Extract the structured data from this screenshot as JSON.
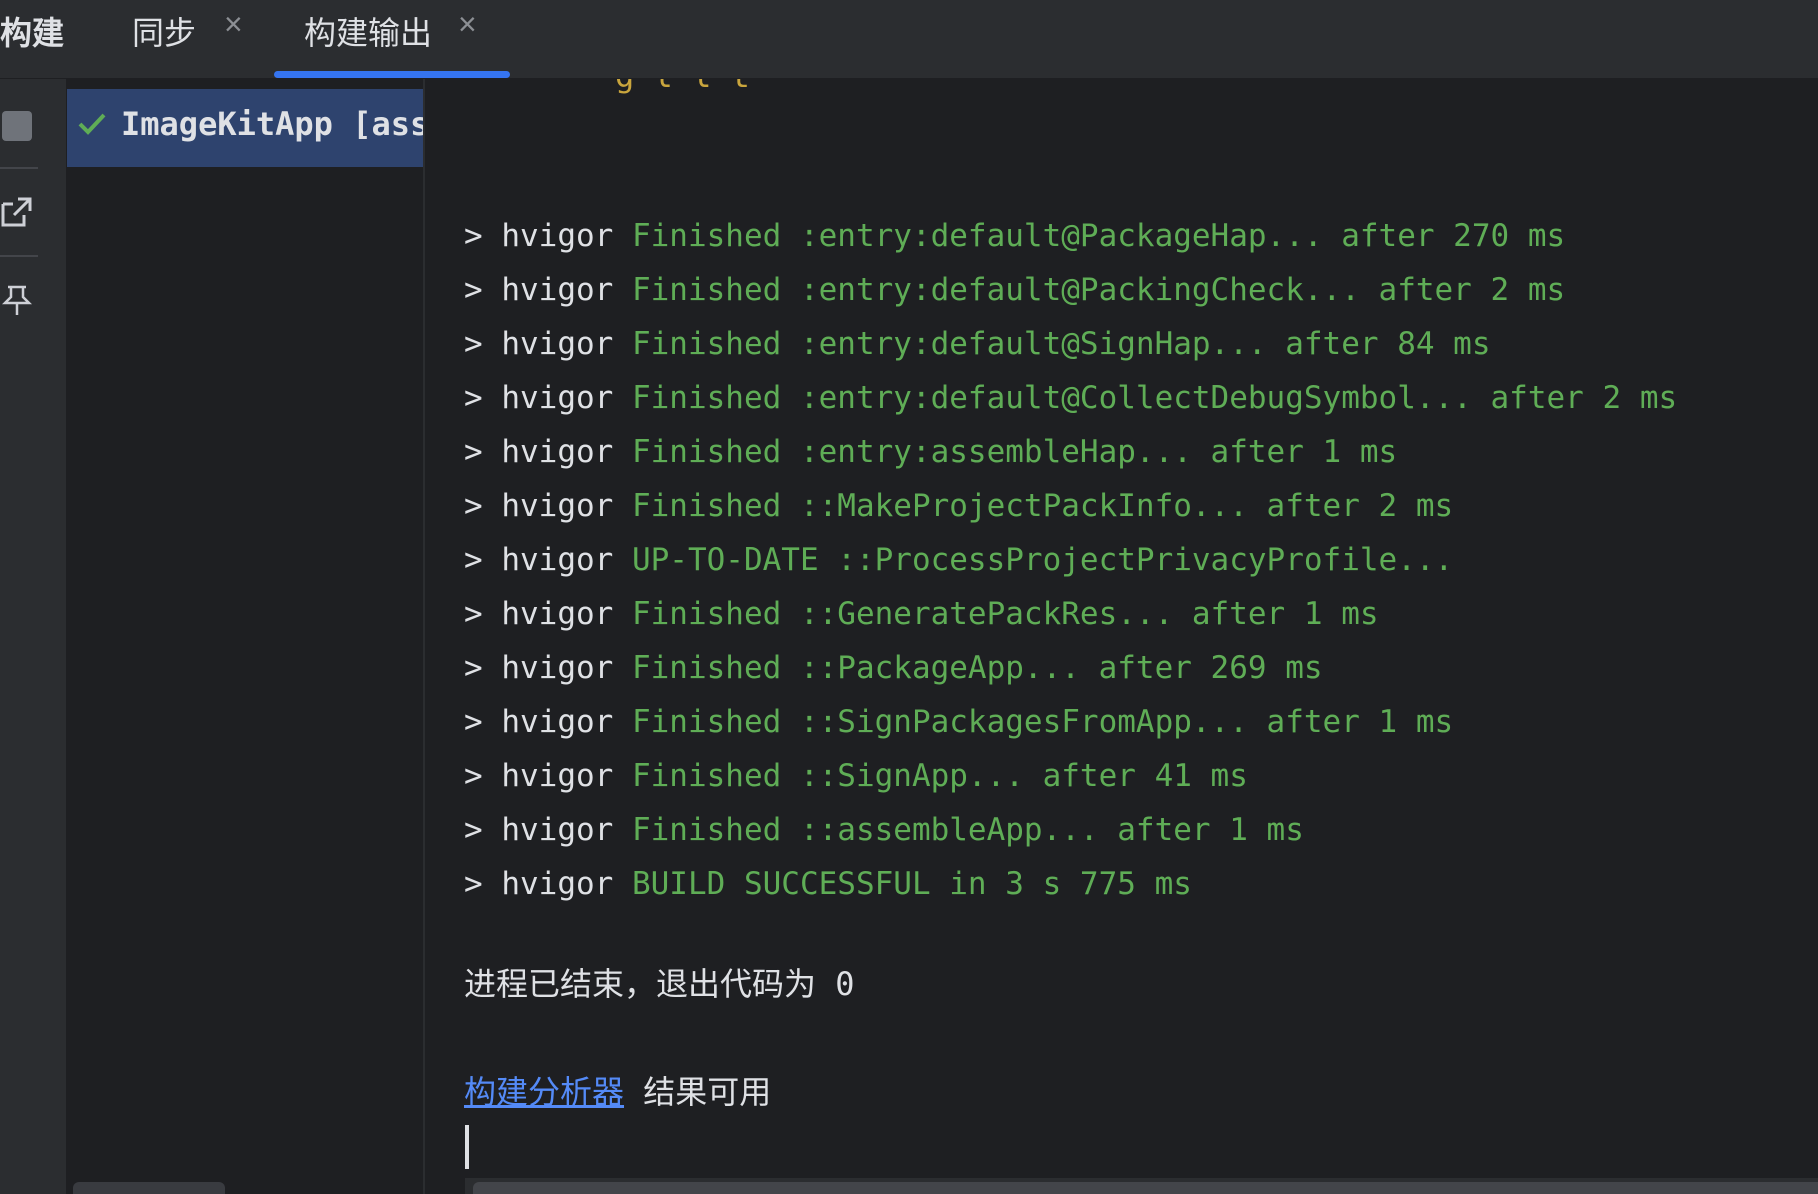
{
  "header": {
    "title": "构建",
    "tabs": [
      {
        "label": "同步",
        "close": "×"
      },
      {
        "label": "构建输出",
        "close": "×"
      }
    ]
  },
  "tree": {
    "item_label": "ImageKitApp [ass",
    "status_icon": "check-icon"
  },
  "console": {
    "cut_line": "   g   l    l  t",
    "lines": [
      {
        "prefix": "> hvigor ",
        "msg": "Finished :entry:default@PackageHap... after 270 ms"
      },
      {
        "prefix": "> hvigor ",
        "msg": "Finished :entry:default@PackingCheck... after 2 ms"
      },
      {
        "prefix": "> hvigor ",
        "msg": "Finished :entry:default@SignHap... after 84 ms"
      },
      {
        "prefix": "> hvigor ",
        "msg": "Finished :entry:default@CollectDebugSymbol... after 2 ms"
      },
      {
        "prefix": "> hvigor ",
        "msg": "Finished :entry:assembleHap... after 1 ms"
      },
      {
        "prefix": "> hvigor ",
        "msg": "Finished ::MakeProjectPackInfo... after 2 ms"
      },
      {
        "prefix": "> hvigor ",
        "msg": "UP-TO-DATE ::ProcessProjectPrivacyProfile..."
      },
      {
        "prefix": "> hvigor ",
        "msg": "Finished ::GeneratePackRes... after 1 ms"
      },
      {
        "prefix": "> hvigor ",
        "msg": "Finished ::PackageApp... after 269 ms"
      },
      {
        "prefix": "> hvigor ",
        "msg": "Finished ::SignPackagesFromApp... after 1 ms"
      },
      {
        "prefix": "> hvigor ",
        "msg": "Finished ::SignApp... after 41 ms"
      },
      {
        "prefix": "> hvigor ",
        "msg": "Finished ::assembleApp... after 1 ms"
      },
      {
        "prefix": "> hvigor ",
        "msg": "BUILD SUCCESSFUL in 3 s 775 ms"
      }
    ],
    "exit_message": "进程已结束，退出代码为 0",
    "analyzer_link": "构建分析器",
    "analyzer_suffix": " 结果可用"
  },
  "colors": {
    "accent": "#3574f0",
    "success": "#5fad56",
    "link": "#548af7",
    "selection": "#2e436e"
  }
}
